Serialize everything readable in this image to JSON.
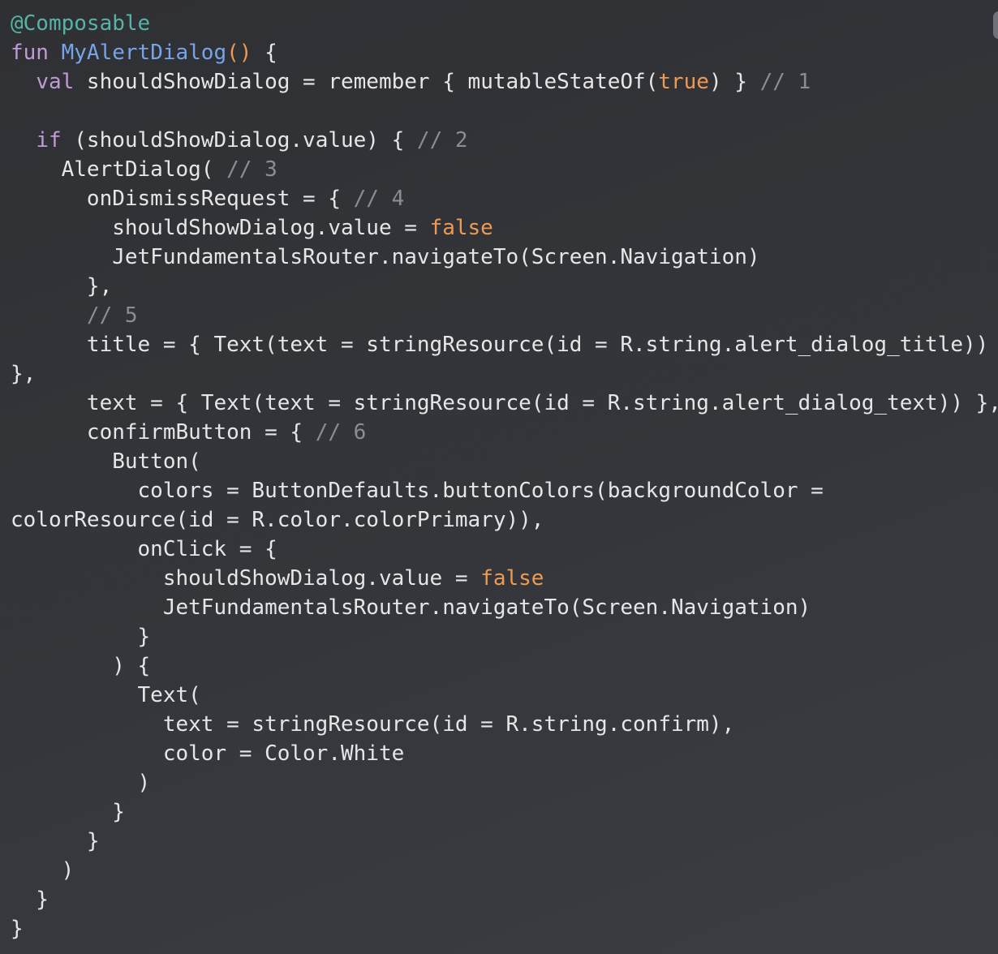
{
  "editor": {
    "colors": {
      "background": "#34363b",
      "text": "#e6e6e6",
      "annotation": "#56b3a6",
      "keyword": "#c19ad6",
      "function": "#77a4e8",
      "literal": "#ef9a52",
      "comment": "#8a8d93"
    },
    "lines": [
      [
        {
          "text": "@Composable",
          "kind": "annotation"
        }
      ],
      [
        {
          "text": "fun ",
          "kind": "keyword"
        },
        {
          "text": "MyAlertDialog",
          "kind": "fn"
        },
        {
          "text": "()",
          "kind": "literal"
        },
        {
          "text": " {",
          "kind": "plain"
        }
      ],
      [
        {
          "text": "  ",
          "kind": "plain"
        },
        {
          "text": "val",
          "kind": "keyword"
        },
        {
          "text": " shouldShowDialog = remember { mutableStateOf(",
          "kind": "plain"
        },
        {
          "text": "true",
          "kind": "literal"
        },
        {
          "text": ") } ",
          "kind": "plain"
        },
        {
          "text": "// 1",
          "kind": "comment"
        }
      ],
      [
        {
          "text": "",
          "kind": "plain"
        }
      ],
      [
        {
          "text": "  ",
          "kind": "plain"
        },
        {
          "text": "if",
          "kind": "keyword"
        },
        {
          "text": " (shouldShowDialog.value) { ",
          "kind": "plain"
        },
        {
          "text": "// 2",
          "kind": "comment"
        }
      ],
      [
        {
          "text": "    AlertDialog( ",
          "kind": "plain"
        },
        {
          "text": "// 3",
          "kind": "comment"
        }
      ],
      [
        {
          "text": "      onDismissRequest = { ",
          "kind": "plain"
        },
        {
          "text": "// 4",
          "kind": "comment"
        }
      ],
      [
        {
          "text": "        shouldShowDialog.value = ",
          "kind": "plain"
        },
        {
          "text": "false",
          "kind": "literal"
        }
      ],
      [
        {
          "text": "        JetFundamentalsRouter.navigateTo(Screen.Navigation)",
          "kind": "plain"
        }
      ],
      [
        {
          "text": "      },",
          "kind": "plain"
        }
      ],
      [
        {
          "text": "      ",
          "kind": "plain"
        },
        {
          "text": "// 5",
          "kind": "comment"
        }
      ],
      [
        {
          "text": "      title = { Text(text = stringResource(id = R.string.alert_dialog_title))",
          "kind": "plain"
        }
      ],
      [
        {
          "text": "},",
          "kind": "plain"
        }
      ],
      [
        {
          "text": "      text = { Text(text = stringResource(id = R.string.alert_dialog_text)) },",
          "kind": "plain"
        }
      ],
      [
        {
          "text": "      confirmButton = { ",
          "kind": "plain"
        },
        {
          "text": "// 6",
          "kind": "comment"
        }
      ],
      [
        {
          "text": "        Button(",
          "kind": "plain"
        }
      ],
      [
        {
          "text": "          colors = ButtonDefaults.buttonColors(backgroundColor =",
          "kind": "plain"
        }
      ],
      [
        {
          "text": "colorResource(id = R.color.colorPrimary)),",
          "kind": "plain"
        }
      ],
      [
        {
          "text": "          onClick = {",
          "kind": "plain"
        }
      ],
      [
        {
          "text": "            shouldShowDialog.value = ",
          "kind": "plain"
        },
        {
          "text": "false",
          "kind": "literal"
        }
      ],
      [
        {
          "text": "            JetFundamentalsRouter.navigateTo(Screen.Navigation)",
          "kind": "plain"
        }
      ],
      [
        {
          "text": "          }",
          "kind": "plain"
        }
      ],
      [
        {
          "text": "        ) {",
          "kind": "plain"
        }
      ],
      [
        {
          "text": "          Text(",
          "kind": "plain"
        }
      ],
      [
        {
          "text": "            text = stringResource(id = R.string.confirm),",
          "kind": "plain"
        }
      ],
      [
        {
          "text": "            color = Color.White",
          "kind": "plain"
        }
      ],
      [
        {
          "text": "          )",
          "kind": "plain"
        }
      ],
      [
        {
          "text": "        }",
          "kind": "plain"
        }
      ],
      [
        {
          "text": "      }",
          "kind": "plain"
        }
      ],
      [
        {
          "text": "    )",
          "kind": "plain"
        }
      ],
      [
        {
          "text": "  }",
          "kind": "plain"
        }
      ],
      [
        {
          "text": "}",
          "kind": "plain"
        }
      ]
    ]
  }
}
